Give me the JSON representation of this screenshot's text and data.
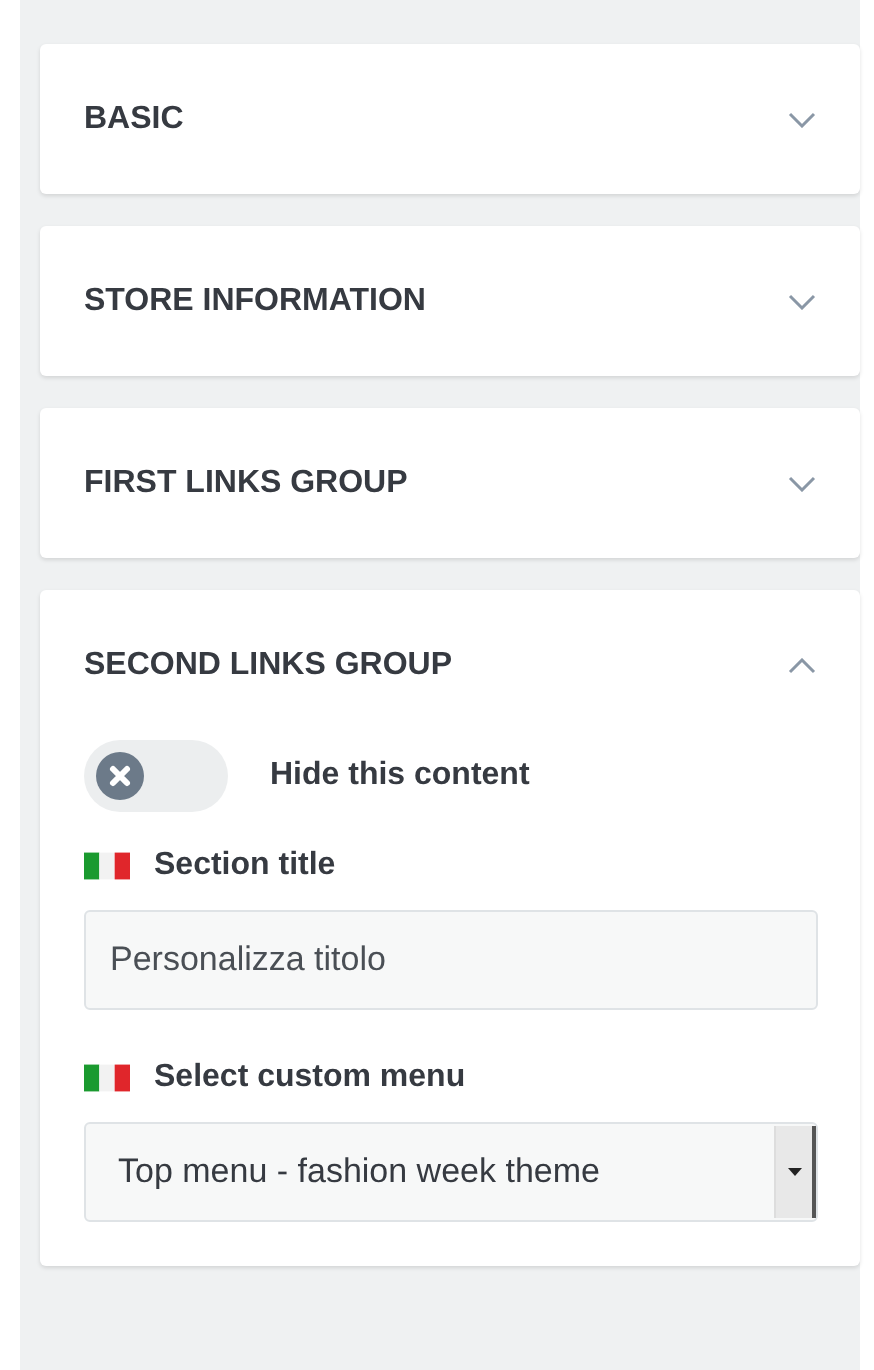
{
  "sections": [
    {
      "title": "BASIC",
      "expanded": false
    },
    {
      "title": "STORE INFORMATION",
      "expanded": false
    },
    {
      "title": "FIRST LINKS GROUP",
      "expanded": false
    },
    {
      "title": "SECOND LINKS GROUP",
      "expanded": true,
      "toggle": {
        "label": "Hide this content",
        "on": false
      },
      "fields": [
        {
          "kind": "text",
          "label": "Section title",
          "value": "Personalizza titolo"
        },
        {
          "kind": "select",
          "label": "Select custom menu",
          "value": "Top menu - fashion week theme"
        }
      ]
    }
  ]
}
